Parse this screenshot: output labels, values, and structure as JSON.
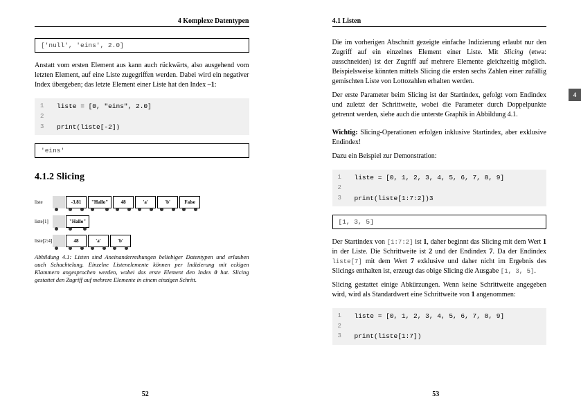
{
  "left": {
    "header": "4 Komplexe Datentypen",
    "out1": "['null', 'eins', 2.0]",
    "para1_a": "Anstatt vom ersten Element aus kann auch rückwärts, also ausgehend vom letzten Element, auf eine Liste zugegriffen werden. Dabei wird ein negativer Index übergeben; das letzte Element einer Liste hat den Index ",
    "para1_idx": "–1",
    "para1_b": ":",
    "code1": {
      "l1": "liste = [0, \"eins\", 2.0]",
      "l2": "",
      "l3": "print(liste[-2])"
    },
    "out2": "'eins'",
    "subsection": "4.1.2 Slicing",
    "fig_labels": {
      "a": "liste",
      "b": "liste[1]",
      "c": "liste[2:4]"
    },
    "wagons": {
      "w0": "-3.81",
      "w1": "\"Hallo\"",
      "w2": "48",
      "w3": "'a'",
      "w4": "'b'",
      "w5": "False"
    },
    "caption_a": "Abbildung 4.1: Listen sind Aneinanderreihungen beliebiger Datentypen und erlauben auch Schachtelung. Einzelne Listenelemente können per Indizierung mit eckigen Klammern angesprochen werden, wobei das erste Element den Index ",
    "caption_zero": "0",
    "caption_b": " hat. Slicing gestattet den Zugriff auf mehrere Elemente in einem einzigen Schritt.",
    "pagenum": "52"
  },
  "right": {
    "header": "4.1 Listen",
    "para1_a": "Die im vorherigen Abschnitt gezeigte einfache Indizierung erlaubt nur den Zugriff auf ein einzelnes Element einer Liste. Mit ",
    "para1_slicing": "Slicing",
    "para1_b": " (etwa: ausschneiden) ist der Zugriff auf mehrere Elemente gleichzeitig möglich. Beispielsweise könnten mittels Slicing die ersten sechs Zahlen einer zufällig gemischten Liste von Lottozahlen erhalten werden.",
    "para2": "Der erste Parameter beim Slicing ist der Startindex, gefolgt vom Endindex und zuletzt der Schrittweite, wobei die Parameter durch Doppelpunkte getrennt werden, siehe auch die unterste Graphik in Abbildung 4.1.",
    "wichtig_label": "Wichtig:",
    "wichtig_text": " Slicing-Operationen erfolgen inklusive Startindex, aber exklusive Endindex!",
    "para3": "Dazu ein Beispiel zur Demonstration:",
    "code1": {
      "l1": "liste = [0, 1, 2, 3, 4, 5, 6, 7, 8, 9]",
      "l2": "",
      "l3": "print(liste[1:7:2])3"
    },
    "out1": "[1, 3, 5]",
    "p4_a": "Der Startindex von ",
    "p4_m1": "[1:7:2]",
    "p4_b": " ist ",
    "p4_one": "1",
    "p4_c": ", daher beginnt das Slicing mit dem Wert ",
    "p4_one2": "1",
    "p4_d": " in der Liste. Die Schrittweite ist ",
    "p4_two": "2",
    "p4_e": " und der Endindex ",
    "p4_seven": "7",
    "p4_f": ". Da der Endindex ",
    "p4_m2": "liste[7]",
    "p4_g": " mit dem Wert ",
    "p4_seven2": "7",
    "p4_h": " exklusive und daher nicht im Ergebnis des Slicings enthalten ist, erzeugt das obige Slicing die Ausgabe ",
    "p4_m3": "[1, 3, 5]",
    "p4_i": ".",
    "p5_a": "Slicing gestattet einige Abkürzungen. Wenn keine Schrittweite angegeben wird, wird als Standardwert eine Schrittweite von ",
    "p5_one": "1",
    "p5_b": " angenommen:",
    "code2": {
      "l1": "liste = [0, 1, 2, 3, 4, 5, 6, 7, 8, 9]",
      "l2": "",
      "l3": "print(liste[1:7])"
    },
    "pagenum": "53",
    "tab": "4"
  }
}
